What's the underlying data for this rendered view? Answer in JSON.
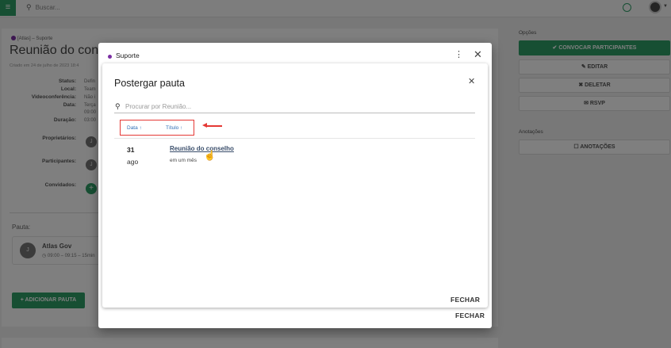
{
  "topbar": {
    "menu_glyph": "≡",
    "search_icon": "search-icon",
    "search_placeholder": "Buscar..."
  },
  "background": {
    "tag": "[Atlas] – Suporte",
    "title": "Reunião do conselho",
    "created": "Criado em 24 de julho de 2023 18:4",
    "labels": [
      "Status:",
      "Local:",
      "Videoconferência:",
      "Data:",
      "Duração:",
      "Proprietários:",
      "Participantes:",
      "Convidados:"
    ],
    "values": {
      "status": "Defin",
      "local": "Team",
      "video": "Não i",
      "data1": "Terça",
      "data2": "09:00",
      "duracao": "03:00"
    },
    "avatar_initial": "J",
    "pauta_heading": "Pauta:",
    "agenda_item": {
      "initial": "J",
      "name": "Atlas Gov",
      "time": "◷ 09:00 – 09:15 – 15min"
    },
    "add_pauta": "+ ADICIONAR PAUTA"
  },
  "sidebar": {
    "options_title": "Opções",
    "buttons": [
      "✔ CONVOCAR PARTICIPANTES",
      "✎ EDITAR",
      "✖ DELETAR",
      "✉ RSVP"
    ],
    "annotations_title": "Anotações",
    "annotations_button": "☐ ANOTAÇÕES",
    "accent_color": "#2e9e67"
  },
  "outer_dialog": {
    "title": "Suporte",
    "more_glyph": "⋮",
    "close_glyph": "✕",
    "footer_button": "FECHAR"
  },
  "inner_dialog": {
    "title": "Postergar pauta",
    "close_glyph": "✕",
    "search_placeholder": "Procurar por Reunião...",
    "sort": [
      {
        "label": "Data ↑"
      },
      {
        "label": "Título ↑"
      }
    ],
    "items": [
      {
        "day": "31",
        "month": "ago",
        "title": "Reunião do conselho",
        "relative": "em um mês"
      }
    ],
    "footer_button": "FECHAR"
  },
  "annotation_color": "#e53935"
}
